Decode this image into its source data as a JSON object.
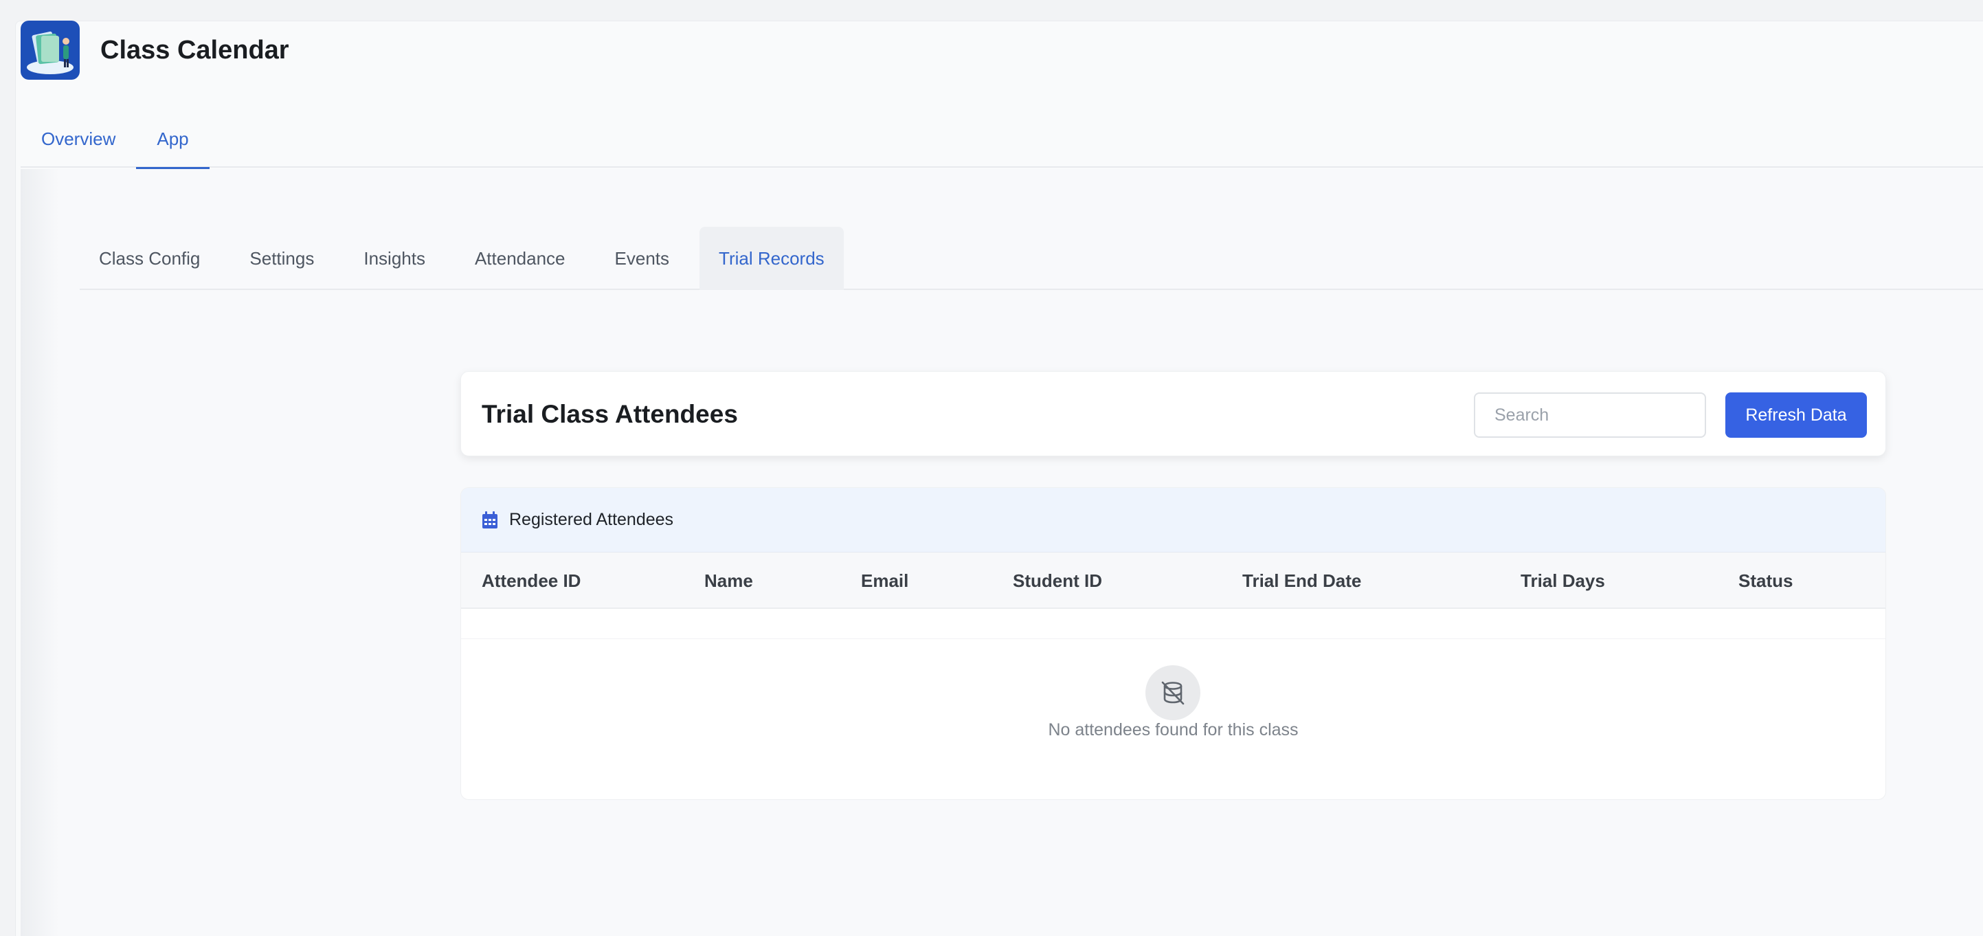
{
  "app": {
    "title": "Class Calendar",
    "logo": "class-calendar-logo"
  },
  "top_tabs": [
    {
      "label": "Overview",
      "active": false
    },
    {
      "label": "App",
      "active": true
    }
  ],
  "sub_tabs": [
    {
      "label": "Class Config",
      "active": false
    },
    {
      "label": "Settings",
      "active": false
    },
    {
      "label": "Insights",
      "active": false
    },
    {
      "label": "Attendance",
      "active": false
    },
    {
      "label": "Events",
      "active": false
    },
    {
      "label": "Trial Records",
      "active": true
    }
  ],
  "panel": {
    "title": "Trial Class Attendees",
    "search_placeholder": "Search",
    "search_value": "",
    "refresh_label": "Refresh Data"
  },
  "table": {
    "header_icon": "calendar-icon",
    "header_title": "Registered Attendees",
    "columns": [
      "Attendee ID",
      "Name",
      "Email",
      "Student ID",
      "Trial End Date",
      "Trial Days",
      "Status"
    ],
    "rows": [],
    "empty_icon": "no-data-icon",
    "empty_text": "No attendees found for this class"
  },
  "colors": {
    "accent": "#3366cc",
    "button": "#3662e3",
    "card_header_bg": "#eef4fd"
  }
}
